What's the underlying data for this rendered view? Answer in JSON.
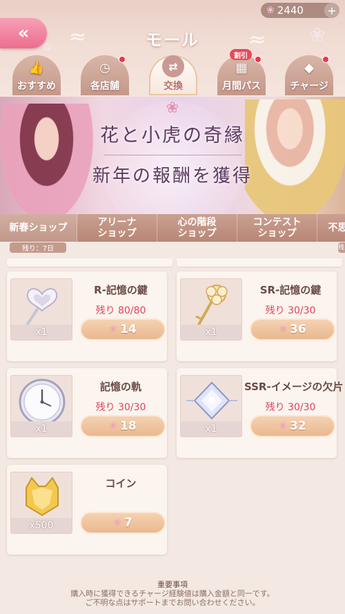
{
  "header": {
    "title": "モール",
    "back_icon": "double-chevron-left-icon",
    "currency": {
      "amount": "2440",
      "icon": "rose-icon",
      "add_label": "+"
    }
  },
  "tabs": [
    {
      "label": "おすすめ",
      "icon": "thumbs-up-icon",
      "active": false,
      "dot": false
    },
    {
      "label": "各店舗",
      "icon": "clock-bag-icon",
      "active": false,
      "dot": true
    },
    {
      "label": "交換",
      "icon": "exchange-icon",
      "active": true,
      "dot": false
    },
    {
      "label": "月間パス",
      "icon": "calendar-icon",
      "active": false,
      "dot": true,
      "badge": "割引"
    },
    {
      "label": "チャージ",
      "icon": "diamond-icon",
      "active": false,
      "dot": true
    }
  ],
  "banner": {
    "title": "花と小虎の奇縁",
    "subtitle": "新年の報酬を獲得"
  },
  "shop_tabs": [
    {
      "label": "新春ショップ",
      "active": true
    },
    {
      "label": "アリーナ\nショップ",
      "active": false
    },
    {
      "label": "心の階段\nショップ",
      "active": false
    },
    {
      "label": "コンテスト\nショップ",
      "active": false
    },
    {
      "label": "不思",
      "active": false
    }
  ],
  "remaining": "残り：7日",
  "remaining_right": "残",
  "items": [
    {
      "name": "R-記憶の鍵",
      "stock": "残り 80/80",
      "quantity": "x1",
      "price": "14",
      "icon": "heart-key-icon"
    },
    {
      "name": "SR-記憶の鍵",
      "stock": "残り 30/30",
      "quantity": "x1",
      "price": "36",
      "icon": "gold-key-icon"
    },
    {
      "name": "記憶の軌",
      "stock": "残り 30/30",
      "quantity": "x1",
      "price": "18",
      "icon": "clock-icon"
    },
    {
      "name": "SSR-イメージの欠片",
      "stock": "残り 30/30",
      "quantity": "x1",
      "price": "32",
      "icon": "crystal-icon"
    },
    {
      "name": "コイン",
      "stock": "",
      "quantity": "x500",
      "price": "7",
      "icon": "cat-coin-icon"
    }
  ],
  "footer": {
    "heading": "重要事項",
    "line1": "購入時に獲得できるチャージ経験値は購入金額と同一です。",
    "line2": "ご不明な点はサポートまでお問い合わせください。"
  },
  "colors": {
    "accent_pink": "#ec6d8e",
    "stock_red": "#e0425a",
    "button_gold": "#eab88f",
    "tab_brown": "#b88676"
  }
}
